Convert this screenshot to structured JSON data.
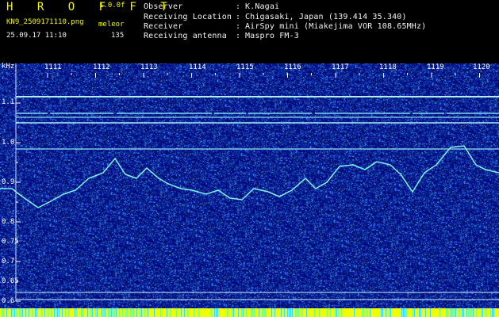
{
  "header": {
    "logo": "H R O F F T",
    "version": "1.0.0f",
    "filename": "KN9_2509171110.png",
    "datetime": "25.09.17 11:10",
    "mode_label": "meleor",
    "count": "135",
    "info_rows": [
      {
        "label": "Observer",
        "sep": ":",
        "value": "K.Nagai"
      },
      {
        "label": "Receiving Location",
        "sep": ":",
        "value": "Chigasaki, Japan (139.414 35.340)"
      },
      {
        "label": "Receiver",
        "sep": ":",
        "value": "AirSpy mini (Miakejima VOR 108.65MHz)"
      },
      {
        "label": "Receiving antenna",
        "sep": ":",
        "value": "Maspro FM-3"
      }
    ]
  },
  "spectrogram": {
    "y_unit": "kHz",
    "y_ticks": [
      "1.1",
      "1.0",
      "0.9",
      "0.8",
      "0.7",
      "0.6"
    ],
    "y_ticks_minor": [
      "0.75",
      "0.65"
    ],
    "x_ticks": [
      "1111",
      "1112",
      "1113",
      "1114",
      "1115",
      "1116",
      "1117",
      "1118",
      "1119",
      "1120"
    ],
    "colors": {
      "background": "#020a8a",
      "noise": "#3a66e6",
      "carrier": "#9fe8ff",
      "trace": "#7ff5ee",
      "bottom_strip_primary": "#f0ff00",
      "bottom_strip_secondary": "#39d9ff"
    }
  }
}
